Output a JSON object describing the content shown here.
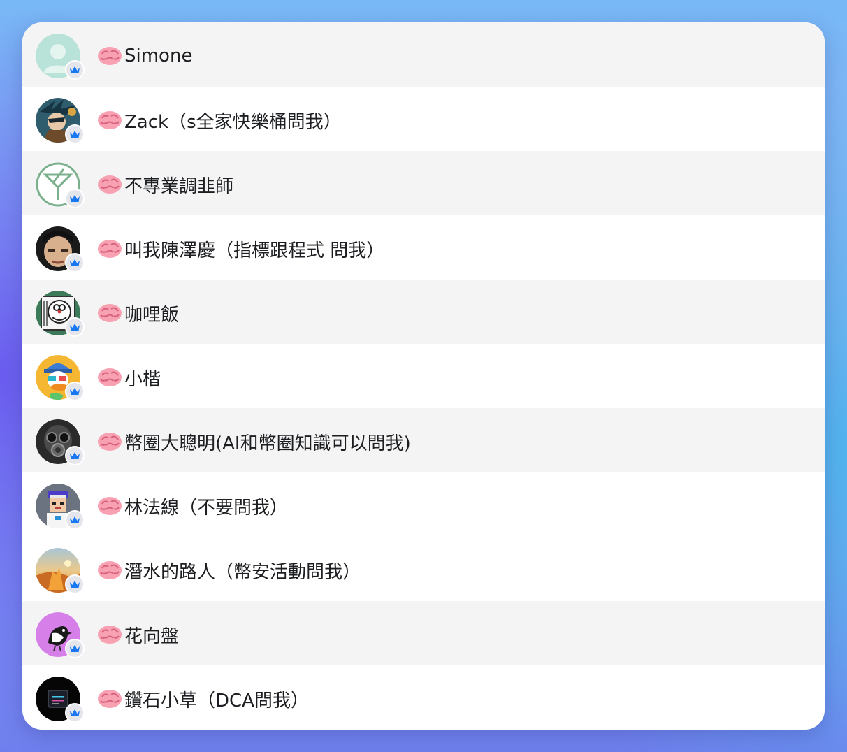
{
  "members": [
    {
      "name": "Simone",
      "avatar": "default-person-avatar"
    },
    {
      "name": "Zack（s全家快樂桶問我）",
      "avatar": "anime-warrior-avatar"
    },
    {
      "name": "不專業調韭師",
      "avatar": "cocktail-glass-logo-avatar"
    },
    {
      "name": "叫我陳澤慶（指標跟程式 問我）",
      "avatar": "person-photo-avatar"
    },
    {
      "name": "咖哩飯",
      "avatar": "doraemon-sketch-avatar"
    },
    {
      "name": "小楷",
      "avatar": "cartoon-duck-avatar"
    },
    {
      "name": "幣圈大聰明(AI和幣圈知識可以問我)",
      "avatar": "gas-mask-avatar"
    },
    {
      "name": "林法線（不要問我）",
      "avatar": "pixel-character-avatar"
    },
    {
      "name": "潛水的路人（幣安活動問我）",
      "avatar": "sunset-landscape-avatar"
    },
    {
      "name": "花向盤",
      "avatar": "bird-avatar"
    },
    {
      "name": "鑽石小草（DCA問我）",
      "avatar": "dark-logo-avatar"
    }
  ],
  "badge_icon": "crown-icon",
  "name_prefix_icon": "brain-emoji-icon",
  "colors": {
    "row_alt": "#f4f4f4",
    "row": "#ffffff",
    "badge_bg": "#e4e6eb",
    "crown": "#1877f2",
    "text": "#1c1e21"
  }
}
